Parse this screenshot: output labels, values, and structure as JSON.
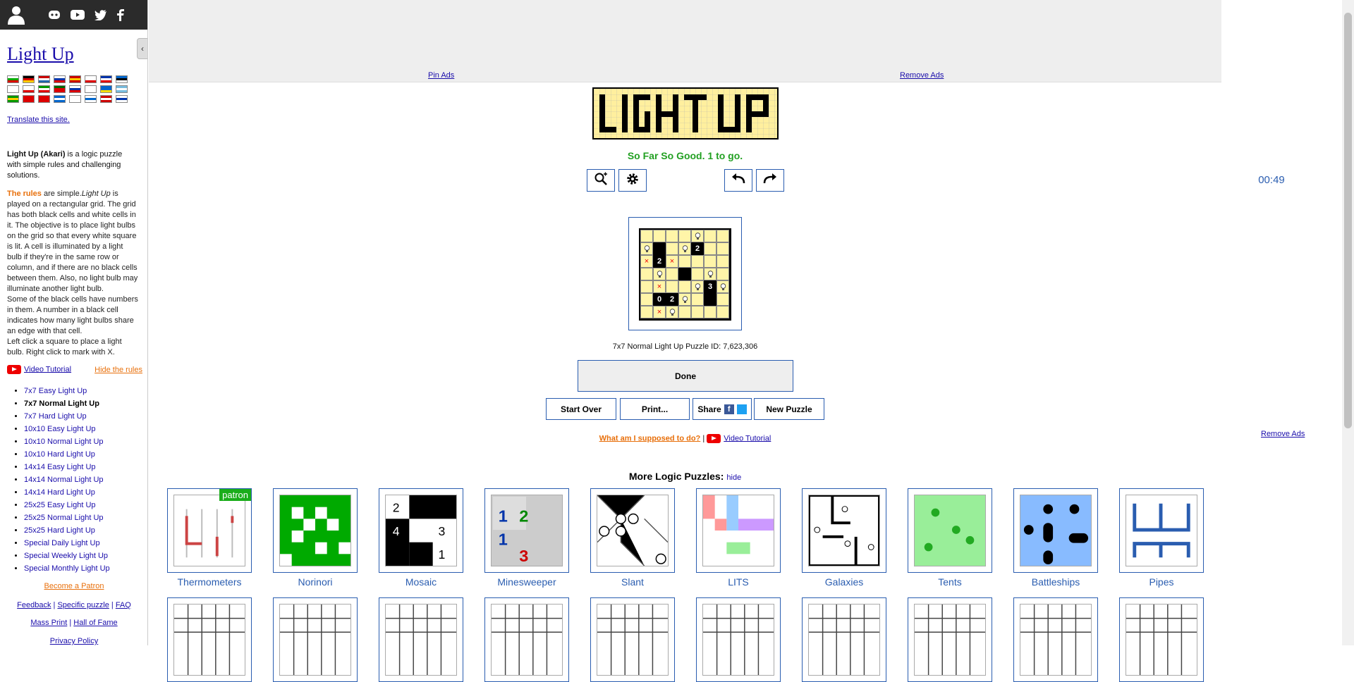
{
  "sidebar": {
    "social_icons": [
      "user-icon",
      "discord-icon",
      "youtube-icon",
      "twitter-icon",
      "facebook-icon"
    ],
    "collapse_glyph": "‹",
    "title": "Light Up",
    "flags": [
      "bg",
      "de",
      "nl",
      "ru",
      "es",
      "pl",
      "fr",
      "ee",
      "jp",
      "cz",
      "it",
      "pt",
      "si",
      "kr",
      "ua",
      "ar",
      "br",
      "cn",
      "vn",
      "gr",
      "kr2",
      "il",
      "dk",
      "fi"
    ],
    "translate": "Translate this site.",
    "intro_bold": "Light Up (Akari)",
    "intro_rest": " is a logic puzzle with simple rules and challenging solutions.",
    "rules_head": "The rules",
    "rules_mid": " are simple.",
    "rules_em": "Light Up",
    "rules_text": " is played on a rectangular grid. The grid has both black cells and white cells in it. The objective is to place light bulbs on the grid so that every white square is lit. A cell is illuminated by a light bulb if they're in the same row or column, and if there are no black cells between them. Also, no light bulb may illuminate another light bulb.",
    "rules_text2": "Some of the black cells have numbers in them. A number in a black cell indicates how many light bulbs share an edge with that cell.",
    "rules_text3": "Left click a square to place a light bulb. Right click to mark with X.",
    "video_tutorial": "Video Tutorial",
    "hide_rules": "Hide the rules",
    "variants": [
      "7x7 Easy Light Up",
      "7x7 Normal Light Up",
      "7x7 Hard Light Up",
      "10x10 Easy Light Up",
      "10x10 Normal Light Up",
      "10x10 Hard Light Up",
      "14x14 Easy Light Up",
      "14x14 Normal Light Up",
      "14x14 Hard Light Up",
      "25x25 Easy Light Up",
      "25x25 Normal Light Up",
      "25x25 Hard Light Up",
      "Special Daily Light Up",
      "Special Weekly Light Up",
      "Special Monthly Light Up"
    ],
    "current_variant_index": 1,
    "become_patron": "Become a Patron",
    "feedback": "Feedback",
    "specific_puzzle": "Specific puzzle",
    "faq": "FAQ",
    "mass_print": "Mass Print",
    "hall_of_fame": "Hall of Fame",
    "privacy": "Privacy Policy",
    "sep": "|"
  },
  "ads": {
    "pin_ads": "Pin Ads",
    "remove_ads": "Remove Ads",
    "remove_ads_right": "Remove Ads"
  },
  "game": {
    "status": "So Far So Good. 1 to go.",
    "timer": "00:49",
    "puzzle_id": "7x7 Normal Light Up Puzzle ID: 7,623,306",
    "done": "Done",
    "start_over": "Start Over",
    "print": "Print...",
    "share": "Share",
    "new_puzzle": "New Puzzle",
    "what_to_do": "What am I supposed to do?",
    "video_tutorial": "Video Tutorial",
    "help_sep": "|",
    "board": [
      [
        " ",
        " ",
        " ",
        " ",
        "b",
        " ",
        " "
      ],
      [
        "b",
        "#",
        " ",
        "b",
        "2",
        " ",
        " "
      ],
      [
        "x",
        "2",
        "x",
        " ",
        " ",
        " ",
        " "
      ],
      [
        " ",
        "b",
        " ",
        "#",
        " ",
        "b",
        " "
      ],
      [
        " ",
        "x",
        " ",
        " ",
        "b",
        "3",
        "b"
      ],
      [
        " ",
        "0",
        "2",
        "b",
        " ",
        "#",
        " "
      ],
      [
        " ",
        "x",
        "b",
        " ",
        " ",
        " ",
        " "
      ]
    ]
  },
  "more": {
    "title": "More Logic Puzzles:",
    "hide": "hide",
    "patron_badge": "patron",
    "tiles": [
      "Thermometers",
      "Norinori",
      "Mosaic",
      "Minesweeper",
      "Slant",
      "LITS",
      "Galaxies",
      "Tents",
      "Battleships",
      "Pipes"
    ]
  },
  "colors": {
    "link": "#1a0dab",
    "accent": "#2a5db0",
    "orange": "#e8700c",
    "green": "#22a022",
    "board_light": "#fff5a8"
  }
}
